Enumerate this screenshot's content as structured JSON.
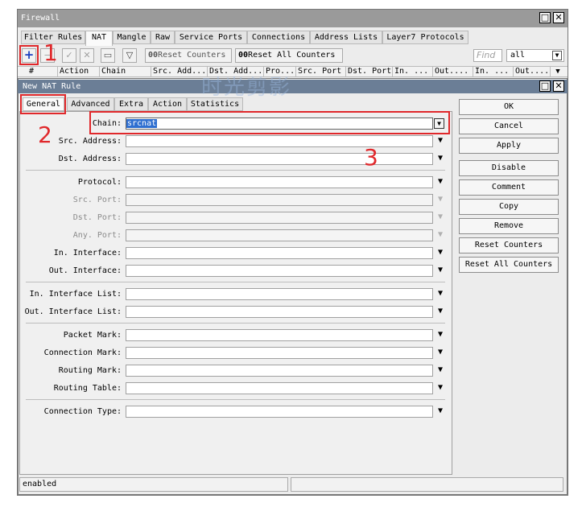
{
  "window": {
    "title": "Firewall"
  },
  "tabs": [
    "Filter Rules",
    "NAT",
    "Mangle",
    "Raw",
    "Service Ports",
    "Connections",
    "Address Lists",
    "Layer7 Protocols"
  ],
  "toolbar": {
    "reset_counters": "Reset Counters",
    "reset_all_counters": "Reset All Counters",
    "oo": "00",
    "find_placeholder": "Find",
    "filter_value": "all"
  },
  "columns": [
    "#",
    "Action",
    "Chain",
    "Src. Add...",
    "Dst. Add...",
    "Pro...",
    "Src. Port",
    "Dst. Port",
    "In. ...",
    "Out....",
    "In. ...",
    "Out...."
  ],
  "dialog": {
    "title": "New NAT Rule",
    "tabs": [
      "General",
      "Advanced",
      "Extra",
      "Action",
      "Statistics"
    ],
    "fields": {
      "chain": {
        "label": "Chain:",
        "value": "srcnat"
      },
      "src_address": {
        "label": "Src. Address:"
      },
      "dst_address": {
        "label": "Dst. Address:"
      },
      "protocol": {
        "label": "Protocol:"
      },
      "src_port": {
        "label": "Src. Port:"
      },
      "dst_port": {
        "label": "Dst. Port:"
      },
      "any_port": {
        "label": "Any. Port:"
      },
      "in_interface": {
        "label": "In. Interface:"
      },
      "out_interface": {
        "label": "Out. Interface:"
      },
      "in_interface_list": {
        "label": "In. Interface List:"
      },
      "out_interface_list": {
        "label": "Out. Interface List:"
      },
      "packet_mark": {
        "label": "Packet Mark:"
      },
      "connection_mark": {
        "label": "Connection Mark:"
      },
      "routing_mark": {
        "label": "Routing Mark:"
      },
      "routing_table": {
        "label": "Routing Table:"
      },
      "connection_type": {
        "label": "Connection Type:"
      }
    },
    "buttons": [
      "OK",
      "Cancel",
      "Apply",
      "Disable",
      "Comment",
      "Copy",
      "Remove",
      "Reset Counters",
      "Reset All Counters"
    ],
    "status": "enabled"
  },
  "annotations": {
    "n1": "1",
    "n2": "2",
    "n3": "3",
    "color": "#e0282b"
  },
  "watermark": "时光剪影"
}
